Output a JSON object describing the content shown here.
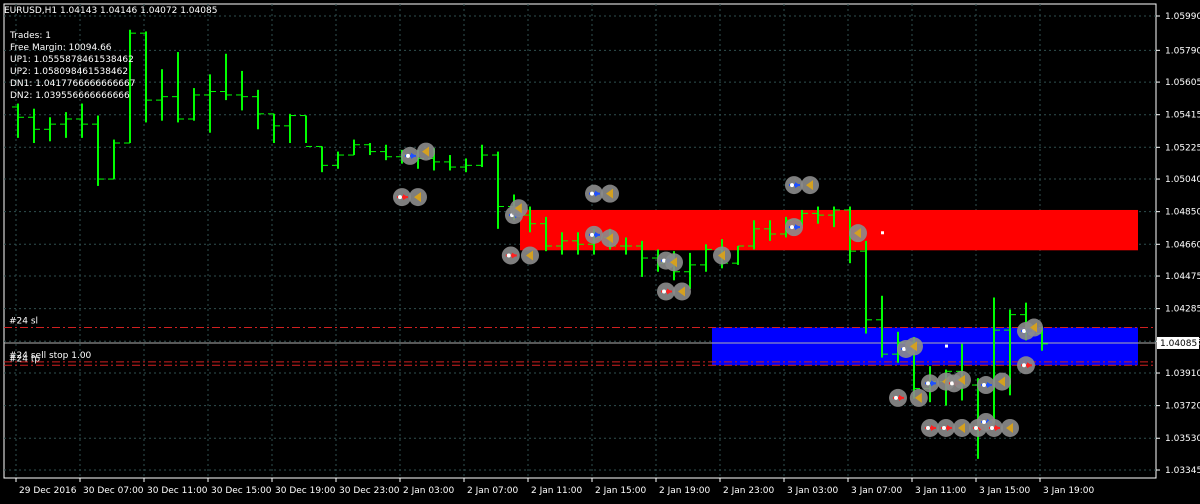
{
  "chart_data": {
    "type": "ohlc",
    "symbol_line": "EURUSD,H1  1.04143 1.04146 1.04072 1.04085",
    "info_lines": [
      "Trades: 1",
      "Free Margin: 10094.66",
      "UP1: 1.05558784615384​62",
      "UP2: 1.05809846153846​2",
      "DN1: 1.04177666666666​67",
      "DN2: 1.03955666666666​6"
    ],
    "current_price": "1.04085",
    "ylim": [
      1.03345,
      1.0599
    ],
    "y_ticks": [
      "1.05990",
      "1.05790",
      "1.05605",
      "1.05415",
      "1.05225",
      "1.05040",
      "1.04850",
      "1.04660",
      "1.04475",
      "1.04285",
      "1.04095",
      "1.03910",
      "1.03720",
      "1.03530",
      "1.03345"
    ],
    "x_ticks": [
      {
        "i": 0,
        "label": "29 Dec 2016"
      },
      {
        "i": 4,
        "label": "30 Dec 07:00"
      },
      {
        "i": 8,
        "label": "30 Dec 11:00"
      },
      {
        "i": 12,
        "label": "30 Dec 15:00"
      },
      {
        "i": 16,
        "label": "30 Dec 19:00"
      },
      {
        "i": 20,
        "label": "30 Dec 23:00"
      },
      {
        "i": 24,
        "label": "2 Jan 03:00"
      },
      {
        "i": 28,
        "label": "2 Jan 07:00"
      },
      {
        "i": 32,
        "label": "2 Jan 11:00"
      },
      {
        "i": 36,
        "label": "2 Jan 15:00"
      },
      {
        "i": 40,
        "label": "2 Jan 19:00"
      },
      {
        "i": 44,
        "label": "2 Jan 23:00"
      },
      {
        "i": 48,
        "label": "3 Jan 03:00"
      },
      {
        "i": 52,
        "label": "3 Jan 07:00"
      },
      {
        "i": 56,
        "label": "3 Jan 11:00"
      },
      {
        "i": 60,
        "label": "3 Jan 15:00"
      },
      {
        "i": 64,
        "label": "3 Jan 19:00"
      }
    ],
    "bars": [
      [
        1.0546,
        1.0548,
        1.0528,
        1.054
      ],
      [
        1.054,
        1.0545,
        1.0525,
        1.0533
      ],
      [
        1.0533,
        1.054,
        1.0526,
        1.0536
      ],
      [
        1.0536,
        1.0543,
        1.0528,
        1.0539
      ],
      [
        1.0539,
        1.0548,
        1.0528,
        1.0536
      ],
      [
        1.0536,
        1.0541,
        1.05,
        1.0504
      ],
      [
        1.0504,
        1.0527,
        1.0504,
        1.0525
      ],
      [
        1.0525,
        1.0591,
        1.0525,
        1.0589
      ],
      [
        1.0589,
        1.059,
        1.0537,
        1.055
      ],
      [
        1.055,
        1.0568,
        1.0538,
        1.0552
      ],
      [
        1.0552,
        1.0578,
        1.0537,
        1.0539
      ],
      [
        1.0539,
        1.0557,
        1.0538,
        1.0553
      ],
      [
        1.0553,
        1.0565,
        1.0531,
        1.0555
      ],
      [
        1.0555,
        1.0577,
        1.055,
        1.0553
      ],
      [
        1.0553,
        1.0567,
        1.0544,
        1.0552
      ],
      [
        1.0552,
        1.0556,
        1.0533,
        1.0542
      ],
      [
        1.0542,
        1.0542,
        1.0525,
        1.0535
      ],
      [
        1.0535,
        1.0542,
        1.0525,
        1.0541
      ],
      [
        1.0541,
        1.0541,
        1.0525,
        1.0523
      ],
      [
        1.0523,
        1.0523,
        1.0508,
        1.0512
      ],
      [
        1.0512,
        1.052,
        1.051,
        1.0518
      ],
      [
        1.0518,
        1.0527,
        1.0518,
        1.0524
      ],
      [
        1.0524,
        1.0525,
        1.0518,
        1.052
      ],
      [
        1.052,
        1.0524,
        1.0515,
        1.0517
      ],
      [
        1.0517,
        1.0521,
        1.0513,
        1.0518
      ],
      [
        1.0518,
        1.0521,
        1.051,
        1.0516
      ],
      [
        1.0516,
        1.0522,
        1.0509,
        1.0514
      ],
      [
        1.0514,
        1.0518,
        1.0509,
        1.0511
      ],
      [
        1.0511,
        1.0516,
        1.0508,
        1.0512
      ],
      [
        1.0512,
        1.0524,
        1.0511,
        1.0518
      ],
      [
        1.0518,
        1.052,
        1.0475,
        1.0488
      ],
      [
        1.0488,
        1.0495,
        1.048,
        1.0483
      ],
      [
        1.0483,
        1.0488,
        1.0473,
        1.0478
      ],
      [
        1.0478,
        1.0482,
        1.0462,
        1.0465
      ],
      [
        1.0465,
        1.0473,
        1.046,
        1.0468
      ],
      [
        1.0468,
        1.0473,
        1.046,
        1.0466
      ],
      [
        1.0466,
        1.0475,
        1.046,
        1.047
      ],
      [
        1.047,
        1.0475,
        1.0463,
        1.0465
      ],
      [
        1.0465,
        1.047,
        1.046,
        1.0465
      ],
      [
        1.0465,
        1.0468,
        1.0447,
        1.0458
      ],
      [
        1.0458,
        1.0463,
        1.045,
        1.0455
      ],
      [
        1.0455,
        1.0462,
        1.0445,
        1.045
      ],
      [
        1.045,
        1.0461,
        1.044,
        1.0454
      ],
      [
        1.0454,
        1.0466,
        1.045,
        1.0463
      ],
      [
        1.0463,
        1.0469,
        1.0452,
        1.0455
      ],
      [
        1.0455,
        1.0465,
        1.0454,
        1.0465
      ],
      [
        1.0465,
        1.048,
        1.0463,
        1.0475
      ],
      [
        1.0475,
        1.048,
        1.0468,
        1.0472
      ],
      [
        1.0472,
        1.0482,
        1.047,
        1.048
      ],
      [
        1.048,
        1.0486,
        1.0477,
        1.0484
      ],
      [
        1.0484,
        1.0488,
        1.0478,
        1.0483
      ],
      [
        1.0483,
        1.0488,
        1.0476,
        1.0486
      ],
      [
        1.0486,
        1.0488,
        1.0455,
        1.0462
      ],
      [
        1.0462,
        1.0468,
        1.0414,
        1.0422
      ],
      [
        1.0422,
        1.0436,
        1.04,
        1.0402
      ],
      [
        1.0402,
        1.0415,
        1.0397,
        1.0409
      ],
      [
        1.0409,
        1.0412,
        1.0376,
        1.0382
      ],
      [
        1.0382,
        1.0395,
        1.0374,
        1.0386
      ],
      [
        1.0386,
        1.0393,
        1.0372,
        1.0392
      ],
      [
        1.0392,
        1.0408,
        1.0375,
        1.0384
      ],
      [
        1.0384,
        1.0388,
        1.0341,
        1.0362
      ],
      [
        1.0362,
        1.0435,
        1.0362,
        1.0416
      ],
      [
        1.0416,
        1.0428,
        1.0378,
        1.0425
      ],
      [
        1.0425,
        1.0432,
        1.041,
        1.0414
      ],
      [
        1.0414,
        1.0418,
        1.0404,
        1.0408
      ]
    ],
    "zones": [
      {
        "name": "resistance-zone",
        "color": "#ff0000",
        "from_i": 31,
        "to_i": 70,
        "y_top": 1.0486,
        "y_bottom": 1.04625
      },
      {
        "name": "support-zone",
        "color": "#0000ff",
        "from_i": 43,
        "to_i": 70,
        "y_top": 1.04175,
        "y_bottom": 1.03955
      }
    ],
    "order_lines": [
      {
        "label": "#24 sl",
        "price": 1.04175,
        "color": "#d02020",
        "style": "dashdot"
      },
      {
        "label": "#24 sell stop 1.00",
        "price": 1.03975,
        "color": "#d02020",
        "style": "dashdot"
      },
      {
        "label": "#24 tp",
        "price": 1.03955,
        "color": "#d02020",
        "style": "dashdot"
      }
    ],
    "current_line_color": "#b0b0b0",
    "markers": [
      {
        "i": 24.5,
        "p": 1.05175,
        "k": "buy"
      },
      {
        "i": 25.5,
        "p": 1.052,
        "k": "close"
      },
      {
        "i": 24.0,
        "p": 1.04935,
        "k": "sell"
      },
      {
        "i": 25.0,
        "p": 1.04935,
        "k": "close"
      },
      {
        "i": 31.0,
        "p": 1.0483,
        "k": "buy"
      },
      {
        "i": 31.3,
        "p": 1.0487,
        "k": "close"
      },
      {
        "i": 30.8,
        "p": 1.04595,
        "k": "sell"
      },
      {
        "i": 32.0,
        "p": 1.04595,
        "k": "close"
      },
      {
        "i": 36.0,
        "p": 1.04955,
        "k": "buy"
      },
      {
        "i": 37.0,
        "p": 1.04955,
        "k": "close"
      },
      {
        "i": 36.0,
        "p": 1.04715,
        "k": "buy"
      },
      {
        "i": 37.0,
        "p": 1.04695,
        "k": "close"
      },
      {
        "i": 40.5,
        "p": 1.04565,
        "k": "buy"
      },
      {
        "i": 41.0,
        "p": 1.04555,
        "k": "close"
      },
      {
        "i": 40.5,
        "p": 1.04385,
        "k": "sell"
      },
      {
        "i": 41.5,
        "p": 1.04385,
        "k": "close"
      },
      {
        "i": 44.0,
        "p": 1.04595,
        "k": "close"
      },
      {
        "i": 48.5,
        "p": 1.05005,
        "k": "buy"
      },
      {
        "i": 49.5,
        "p": 1.05005,
        "k": "close"
      },
      {
        "i": 48.5,
        "p": 1.0476,
        "k": "buy"
      },
      {
        "i": 52.5,
        "p": 1.04725,
        "k": "close"
      },
      {
        "i": 55.5,
        "p": 1.0405,
        "k": "buy"
      },
      {
        "i": 56.0,
        "p": 1.04065,
        "k": "close"
      },
      {
        "i": 55.0,
        "p": 1.03765,
        "k": "sell"
      },
      {
        "i": 56.3,
        "p": 1.03765,
        "k": "close"
      },
      {
        "i": 57.0,
        "p": 1.0385,
        "k": "buy"
      },
      {
        "i": 58.0,
        "p": 1.0386,
        "k": "close"
      },
      {
        "i": 58.5,
        "p": 1.0385,
        "k": "sell"
      },
      {
        "i": 59.0,
        "p": 1.0387,
        "k": "close"
      },
      {
        "i": 60.5,
        "p": 1.0384,
        "k": "buy"
      },
      {
        "i": 61.5,
        "p": 1.0386,
        "k": "close"
      },
      {
        "i": 63.0,
        "p": 1.04155,
        "k": "buy"
      },
      {
        "i": 63.5,
        "p": 1.04175,
        "k": "close"
      },
      {
        "i": 63.0,
        "p": 1.03955,
        "k": "sell"
      },
      {
        "i": 57.0,
        "p": 1.0359,
        "k": "sell"
      },
      {
        "i": 58.0,
        "p": 1.0359,
        "k": "sell"
      },
      {
        "i": 59.0,
        "p": 1.0359,
        "k": "close"
      },
      {
        "i": 60.0,
        "p": 1.0359,
        "k": "sell"
      },
      {
        "i": 60.5,
        "p": 1.03625,
        "k": "buy"
      },
      {
        "i": 61.0,
        "p": 1.0359,
        "k": "sell"
      },
      {
        "i": 62.0,
        "p": 1.0359,
        "k": "close"
      }
    ],
    "points": [
      {
        "i": 54.0,
        "p": 1.0473
      },
      {
        "i": 58.0,
        "p": 1.0407
      }
    ],
    "colors": {
      "background": "#000000",
      "grid": "#2f4f4f",
      "bars": "#00ff00",
      "axis_text": "#ffffff",
      "marker_ring": "#8c8c8c",
      "marker_buy": "#1e50ff",
      "marker_sell": "#ff2020",
      "marker_close": "#d4a020",
      "price_label_bg": "#ffffff",
      "price_label_fg": "#000000"
    }
  }
}
